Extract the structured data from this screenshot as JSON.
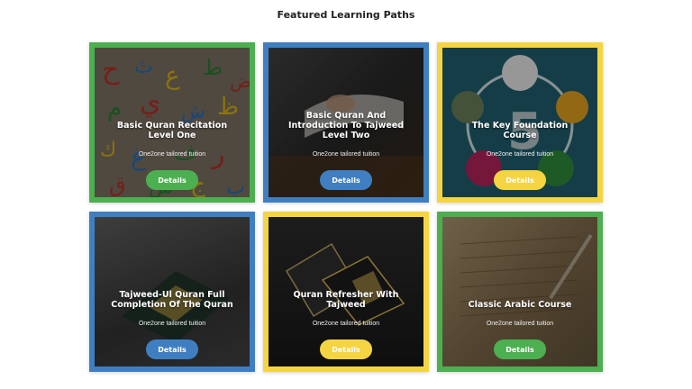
{
  "section": {
    "title": "Featured Learning Paths"
  },
  "cards": [
    {
      "title": "Basic Quran Recitation Level One",
      "subtitle": "One2one tailored tuition",
      "button": "Details",
      "border_color": "#4caf50",
      "button_color": "#4caf50"
    },
    {
      "title": "Basic Quran And Introduction To Tajweed Level Two",
      "subtitle": "One2one tailored tuition",
      "button": "Details",
      "border_color": "#3f7fc1",
      "button_color": "#3f7fc1"
    },
    {
      "title": "The Key Foundation Course",
      "subtitle": "One2one tailored tuition",
      "button": "Details",
      "border_color": "#f5d442",
      "button_color": "#f5d442"
    },
    {
      "title": "Tajweed-Ul Quran Full Completion Of The Quran",
      "subtitle": "One2one tailored tuition",
      "button": "Details",
      "border_color": "#3f7fc1",
      "button_color": "#3f7fc1"
    },
    {
      "title": "Quran Refresher With Tajweed",
      "subtitle": "One2one tailored tuition",
      "button": "Details",
      "border_color": "#f5d442",
      "button_color": "#f5d442"
    },
    {
      "title": "Classic Arabic Course",
      "subtitle": "One2one tailored tuition",
      "button": "Details",
      "border_color": "#4caf50",
      "button_color": "#4caf50"
    }
  ]
}
